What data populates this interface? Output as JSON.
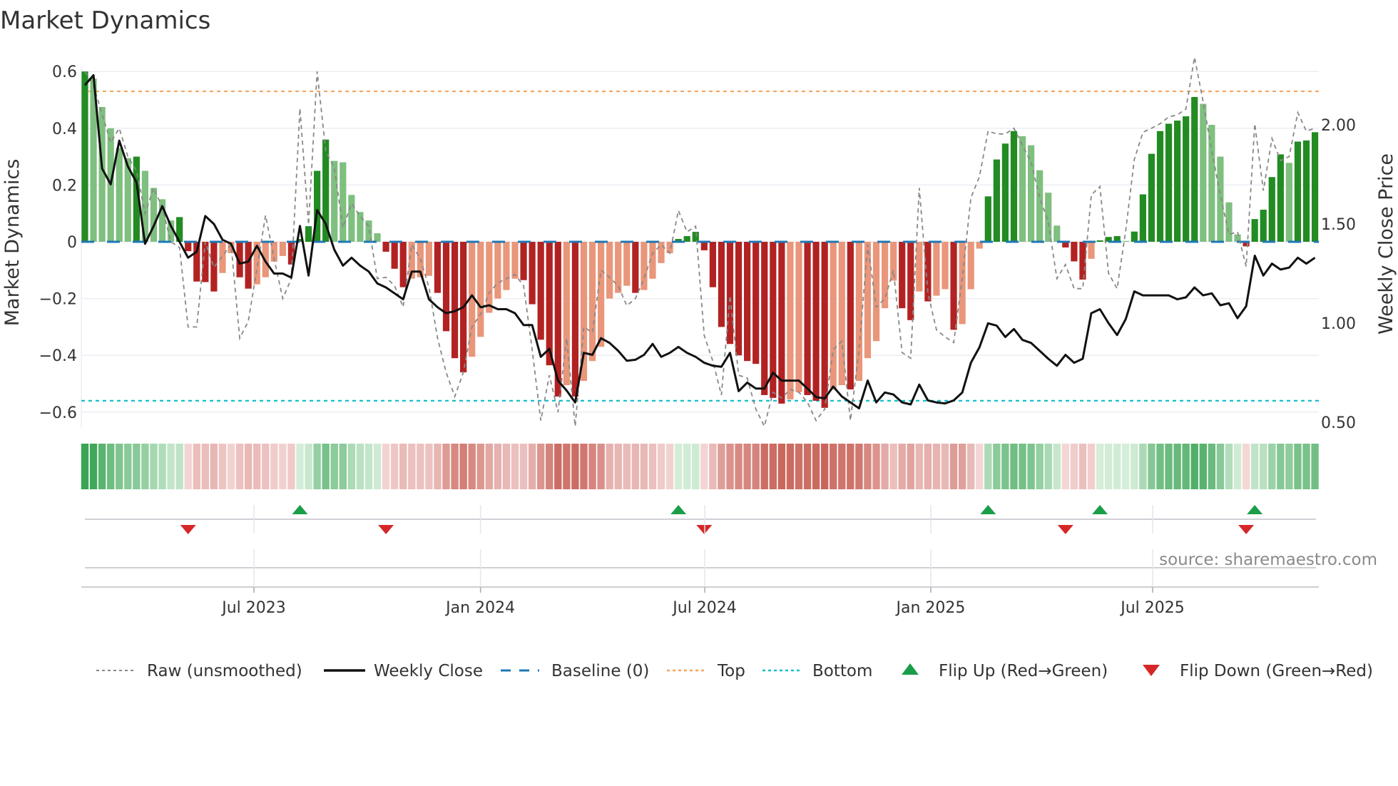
{
  "chart_data": {
    "type": "bar",
    "title": "Market Dynamics",
    "ylabel": "Market Dynamics",
    "y2label": "Weekly Close Price",
    "ylim": [
      -0.65,
      0.65
    ],
    "y2lim": [
      0.47,
      2.27
    ],
    "yticks": [
      {
        "v": 0.6,
        "label": "0.6"
      },
      {
        "v": 0.4,
        "label": "0.4"
      },
      {
        "v": 0.2,
        "label": "0.2"
      },
      {
        "v": 0,
        "label": "0"
      },
      {
        "v": -0.2,
        "label": "−0.2"
      },
      {
        "v": -0.4,
        "label": "−0.4"
      },
      {
        "v": -0.6,
        "label": "−0.6"
      }
    ],
    "y2ticks": [
      {
        "v": 2.0,
        "label": "2.00"
      },
      {
        "v": 1.5,
        "label": "1.50"
      },
      {
        "v": 1.0,
        "label": "1.00"
      },
      {
        "v": 0.5,
        "label": "0.50"
      }
    ],
    "xticks_week_index": [
      {
        "x": 19.65,
        "label": "Jul 2023"
      },
      {
        "x": 45.99,
        "label": "Jan 2024"
      },
      {
        "x": 72.06,
        "label": "Jul 2024"
      },
      {
        "x": 98.34,
        "label": "Jan 2025"
      },
      {
        "x": 124.13,
        "label": "Jul 2025"
      }
    ],
    "top_level": 0.53,
    "bottom_level": -0.56,
    "baseline": 0,
    "momentum": [
      0.6,
      0.575,
      0.475,
      0.4,
      0.33,
      0.295,
      0.3,
      0.25,
      0.19,
      0.15,
      0.075,
      0.087,
      -0.033,
      -0.14,
      -0.142,
      -0.175,
      -0.11,
      -0.04,
      -0.125,
      -0.165,
      -0.15,
      -0.125,
      -0.07,
      -0.05,
      -0.08,
      0.01,
      0.055,
      0.25,
      0.36,
      0.285,
      0.28,
      0.165,
      0.105,
      0.075,
      0.03,
      -0.035,
      -0.095,
      -0.16,
      -0.13,
      -0.125,
      -0.12,
      -0.18,
      -0.315,
      -0.41,
      -0.46,
      -0.405,
      -0.335,
      -0.25,
      -0.2,
      -0.17,
      -0.13,
      -0.135,
      -0.22,
      -0.345,
      -0.435,
      -0.545,
      -0.505,
      -0.545,
      -0.49,
      -0.42,
      -0.37,
      -0.2,
      -0.18,
      -0.155,
      -0.18,
      -0.17,
      -0.13,
      -0.075,
      -0.04,
      0.01,
      0.02,
      0.035,
      -0.03,
      -0.16,
      -0.3,
      -0.36,
      -0.4,
      -0.42,
      -0.43,
      -0.54,
      -0.55,
      -0.57,
      -0.555,
      -0.53,
      -0.54,
      -0.56,
      -0.585,
      -0.52,
      -0.505,
      -0.52,
      -0.49,
      -0.41,
      -0.35,
      -0.234,
      -0.137,
      -0.234,
      -0.276,
      -0.175,
      -0.21,
      -0.19,
      -0.167,
      -0.31,
      -0.29,
      -0.167,
      -0.024,
      0.16,
      0.29,
      0.346,
      0.39,
      0.372,
      0.34,
      0.252,
      0.173,
      0.057,
      -0.02,
      -0.069,
      -0.133,
      -0.06,
      0.005,
      0.017,
      0.02,
      0.003,
      0.036,
      0.167,
      0.31,
      0.39,
      0.416,
      0.427,
      0.442,
      0.51,
      0.486,
      0.412,
      0.3,
      0.139,
      0.026,
      -0.016,
      0.08,
      0.113,
      0.228,
      0.308,
      0.278,
      0.353,
      0.357,
      0.386
    ],
    "raw": [
      0.6,
      0.55,
      0.45,
      0.35,
      0.4,
      0.3,
      0.25,
      0.1,
      0.19,
      0.12,
      0.0,
      -0.02,
      -0.3,
      -0.3,
      0.0,
      -0.09,
      -0.05,
      -0.01,
      -0.34,
      -0.28,
      -0.095,
      0.093,
      -0.06,
      -0.2,
      -0.13,
      0.47,
      0.06,
      0.6,
      0.32,
      0.26,
      0.05,
      0.135,
      0.09,
      0.055,
      -0.13,
      -0.125,
      -0.155,
      -0.23,
      -0.01,
      -0.06,
      -0.16,
      -0.34,
      -0.46,
      -0.545,
      -0.46,
      -0.3,
      -0.255,
      -0.18,
      -0.145,
      -0.13,
      -0.115,
      -0.155,
      -0.38,
      -0.63,
      -0.47,
      -0.6,
      -0.34,
      -0.65,
      -0.3,
      -0.32,
      -0.1,
      -0.125,
      -0.155,
      -0.225,
      -0.2,
      -0.13,
      -0.04,
      -0.01,
      -0.04,
      0.11,
      0.035,
      0.055,
      -0.33,
      -0.42,
      -0.54,
      -0.19,
      -0.47,
      -0.48,
      -0.59,
      -0.65,
      -0.53,
      -0.55,
      -0.52,
      -0.53,
      -0.565,
      -0.63,
      -0.59,
      -0.38,
      -0.35,
      -0.63,
      -0.38,
      -0.01,
      -0.23,
      -0.2,
      -0.1,
      -0.39,
      -0.41,
      0.19,
      -0.18,
      -0.31,
      -0.335,
      -0.355,
      -0.13,
      0.155,
      0.23,
      0.39,
      0.38,
      0.38,
      0.4,
      0.34,
      0.28,
      0.155,
      0.07,
      -0.13,
      -0.08,
      -0.165,
      -0.165,
      0.165,
      0.195,
      -0.11,
      -0.165,
      0.04,
      0.29,
      0.386,
      0.4,
      0.416,
      0.44,
      0.447,
      0.468,
      0.65,
      0.494,
      0.32,
      0.165,
      0.026,
      0.035,
      -0.087,
      0.416,
      0.18,
      0.364,
      0.286,
      0.3,
      0.455,
      0.39,
      0.4
    ],
    "close": [
      2.2,
      2.25,
      1.78,
      1.7,
      1.92,
      1.79,
      1.71,
      1.4,
      1.49,
      1.59,
      1.49,
      1.41,
      1.33,
      1.36,
      1.54,
      1.5,
      1.42,
      1.4,
      1.3,
      1.31,
      1.39,
      1.31,
      1.25,
      1.25,
      1.23,
      1.49,
      1.24,
      1.57,
      1.5,
      1.37,
      1.29,
      1.33,
      1.29,
      1.26,
      1.2,
      1.18,
      1.15,
      1.12,
      1.26,
      1.26,
      1.12,
      1.08,
      1.05,
      1.06,
      1.08,
      1.14,
      1.08,
      1.09,
      1.07,
      1.07,
      1.05,
      0.99,
      0.99,
      0.83,
      0.87,
      0.71,
      0.66,
      0.6,
      0.85,
      0.84,
      0.924,
      0.9,
      0.86,
      0.81,
      0.815,
      0.84,
      0.895,
      0.83,
      0.85,
      0.88,
      0.85,
      0.83,
      0.8,
      0.785,
      0.78,
      0.85,
      0.657,
      0.7,
      0.67,
      0.67,
      0.75,
      0.71,
      0.71,
      0.71,
      0.67,
      0.627,
      0.62,
      0.68,
      0.63,
      0.6,
      0.57,
      0.71,
      0.6,
      0.65,
      0.64,
      0.6,
      0.59,
      0.69,
      0.61,
      0.6,
      0.595,
      0.61,
      0.65,
      0.8,
      0.878,
      0.999,
      0.987,
      0.93,
      0.97,
      0.915,
      0.9,
      0.86,
      0.82,
      0.785,
      0.84,
      0.8,
      0.82,
      1.05,
      1.07,
      1.0,
      0.94,
      1.02,
      1.16,
      1.14,
      1.14,
      1.14,
      1.14,
      1.12,
      1.13,
      1.18,
      1.14,
      1.15,
      1.09,
      1.1,
      1.025,
      1.085,
      1.34,
      1.24,
      1.3,
      1.27,
      1.28,
      1.33,
      1.3,
      1.33
    ],
    "legend": [
      {
        "key": "raw",
        "label": "Raw (unsmoothed)"
      },
      {
        "key": "close",
        "label": "Weekly Close"
      },
      {
        "key": "baseline",
        "label": "Baseline (0)"
      },
      {
        "key": "top",
        "label": "Top"
      },
      {
        "key": "bottom",
        "label": "Bottom"
      },
      {
        "key": "flipup",
        "label": "Flip Up (Red→Green)"
      },
      {
        "key": "flipdown",
        "label": "Flip Down (Green→Red)"
      }
    ],
    "legend_placement": "bottom",
    "source": "source: sharemaestro.com"
  },
  "colors": {
    "bar_up_strong": "#228b22",
    "bar_up_weak": "#7fbf7f",
    "bar_down_strong": "#b22222",
    "bar_down_weak": "#e9967a",
    "raw": "#888888",
    "close": "#111111",
    "baseline": "#1f77b4",
    "top": "#f4a460",
    "bottom": "#17becf",
    "flip_up": "#1a9e4a",
    "flip_down": "#d62728",
    "grid": "#eceef4"
  }
}
